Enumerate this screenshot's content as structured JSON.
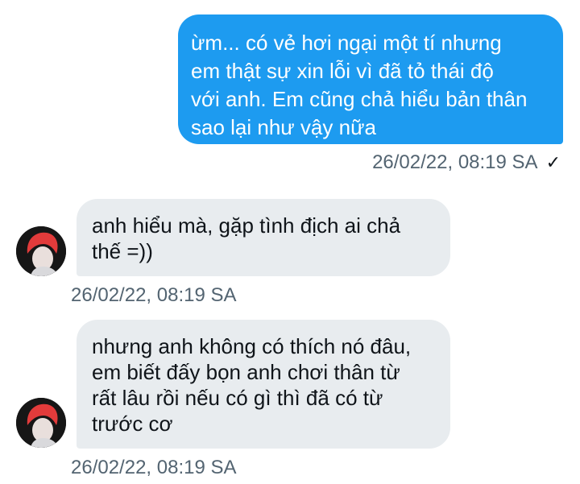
{
  "messages": [
    {
      "direction": "sent",
      "lines": [
        "ừm... có vẻ hơi ngại một tí nhưng",
        "em thật sự xin lỗi vì đã tỏ thái độ",
        "với anh. Em cũng chả hiểu bản thân",
        "sao lại như vậy nữa"
      ],
      "timestamp": "26/02/22, 08:19 SA",
      "status_icon": "check-icon"
    },
    {
      "direction": "received",
      "lines": [
        "anh hiểu mà, gặp tình địch ai chả",
        "thế =))"
      ],
      "timestamp": "26/02/22, 08:19 SA"
    },
    {
      "direction": "received",
      "lines": [
        "nhưng anh không có thích nó đâu,",
        "em biết đấy bọn anh chơi thân từ",
        "rất lâu rồi nếu có gì thì đã có từ",
        "trước cơ"
      ],
      "timestamp": "26/02/22, 08:19 SA"
    }
  ],
  "colors": {
    "sent_bubble": "#1d9bf0",
    "received_bubble": "#e8ecef",
    "timestamp_text": "#536471",
    "avatar_hair": "#e23b3b"
  }
}
